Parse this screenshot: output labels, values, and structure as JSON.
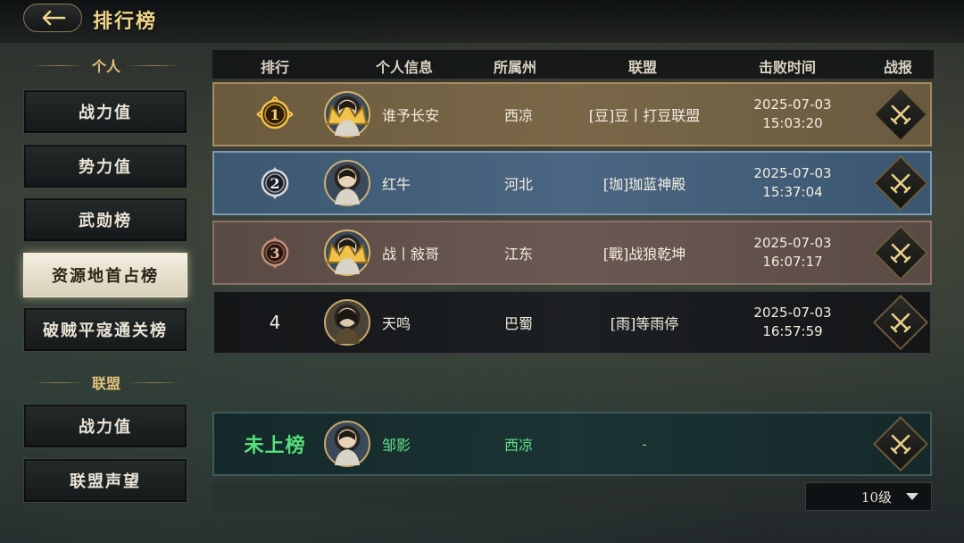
{
  "header": {
    "title": "排行榜"
  },
  "sidebar": {
    "personal_label": "个人",
    "personal_items": [
      {
        "label": "战力值"
      },
      {
        "label": "势力值"
      },
      {
        "label": "武勋榜"
      },
      {
        "label": "资源地首占榜",
        "active": true
      },
      {
        "label": "破贼平寇通关榜"
      }
    ],
    "alliance_label": "联盟",
    "alliance_items": [
      {
        "label": "战力值"
      },
      {
        "label": "联盟声望"
      }
    ]
  },
  "table": {
    "columns": [
      "排行",
      "个人信息",
      "所属州",
      "联盟",
      "击败时间",
      "战报"
    ],
    "rows": [
      {
        "rank": "1",
        "name": "谁予长安",
        "region": "西凉",
        "alliance": "[豆]豆丨打豆联盟",
        "date": "2025-07-03",
        "time": "15:03:20",
        "medal": "gold"
      },
      {
        "rank": "2",
        "name": "红牛",
        "region": "河北",
        "alliance": "[珈]珈蓝神殿",
        "date": "2025-07-03",
        "time": "15:37:04",
        "medal": "silver"
      },
      {
        "rank": "3",
        "name": "战丨敍哥",
        "region": "江东",
        "alliance": "[戰]战狼乾坤",
        "date": "2025-07-03",
        "time": "16:07:17",
        "medal": "bronze"
      },
      {
        "rank": "4",
        "name": "天鸣",
        "region": "巴蜀",
        "alliance": "[雨]等雨停",
        "date": "2025-07-03",
        "time": "16:57:59"
      }
    ],
    "my_row": {
      "rank": "未上榜",
      "name": "邹影",
      "region": "西凉",
      "alliance": "-"
    }
  },
  "footer": {
    "level_select": "10级"
  },
  "colors": {
    "accent": "#f0d68a",
    "my_row_text": "#5fe08a"
  }
}
